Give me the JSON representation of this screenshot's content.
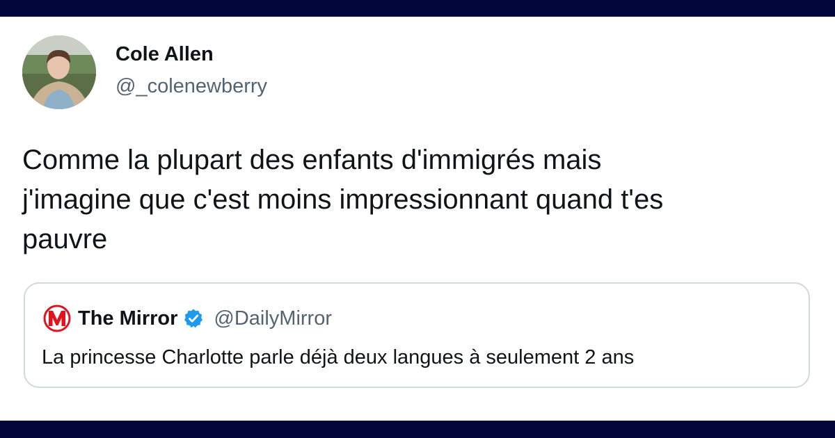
{
  "tweet": {
    "author": {
      "name": "Cole Allen",
      "handle": "@_colenewberry",
      "avatar_icon": "profile-photo"
    },
    "text_lines": [
      "Comme la plupart des enfants d'immigrés mais",
      "j'imagine que c'est moins impressionnant quand t'es",
      "pauvre"
    ]
  },
  "quote": {
    "logo_icon": "mirror-logo-icon",
    "name": "The Mirror",
    "verified_icon": "verified-badge-icon",
    "handle": "@DailyMirror",
    "text": "La princesse Charlotte parle déjà deux langues à seulement 2 ans"
  },
  "colors": {
    "frame_bar": "#03063b",
    "text_primary": "#0f1419",
    "text_secondary": "#536471",
    "card_border": "#cfd9de",
    "verified_blue": "#1d9bf0",
    "mirror_red": "#e0141e"
  }
}
